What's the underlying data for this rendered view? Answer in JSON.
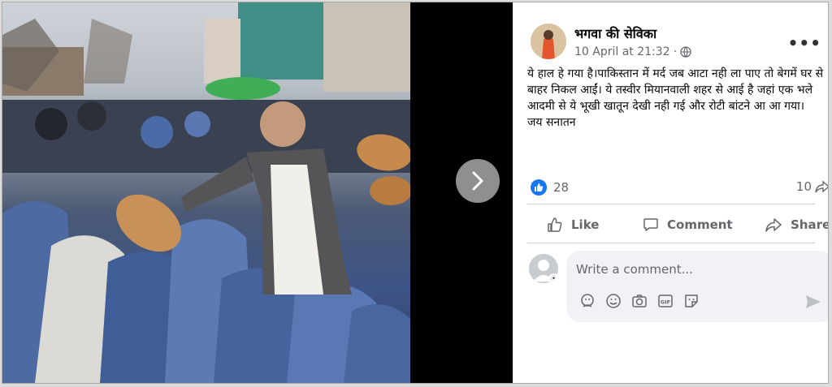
{
  "post": {
    "author": "भगवा की सेविका",
    "timestamp": "10 April at 21:32",
    "privacy_sep": "·",
    "body": "ये हाल हे गया है।पाकिस्तान में मर्द जब आटा नही ला पाए तो बेगमें घर से बाहर निकल आईं। ये तस्वीर मियानवाली शहर से आई है जहां एक भले आदमी से ये भूखी खातून देखी नही गई और रोटी बांटने आ आ गया।\nजय सनातन",
    "reactions_count": "28",
    "shares_count": "10"
  },
  "actions": {
    "like_label": "Like",
    "comment_label": "Comment",
    "share_label": "Share"
  },
  "composer": {
    "placeholder": "Write a comment..."
  },
  "icons": {
    "more": "more-options-icon",
    "privacy": "globe-icon",
    "next": "chevron-right-icon",
    "emoji_tools": [
      "avatar-sticker-icon",
      "emoji-icon",
      "camera-icon",
      "gif-icon",
      "sticker-icon"
    ],
    "send": "send-icon"
  },
  "colors": {
    "accent": "#1877f2",
    "secondary_text": "#65676b",
    "composer_bg": "#f0f2f5"
  }
}
